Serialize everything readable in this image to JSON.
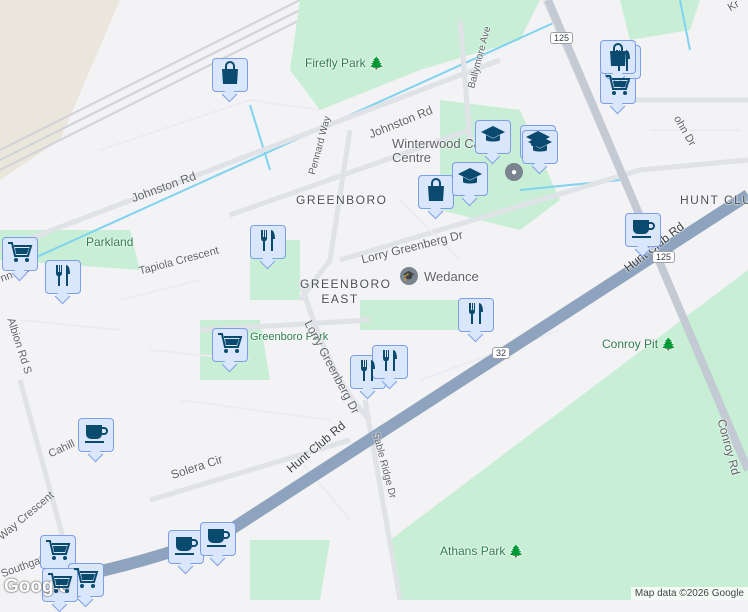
{
  "map": {
    "area_labels": {
      "greenboro": "GREENBORO",
      "greenboro_east": "GREENBORO EAST",
      "hunt_club": "HUNT CLUB"
    },
    "parks": {
      "firefly": "Firefly Park",
      "parkland": "Parkland",
      "greenboro_park": "Greenboro Park",
      "conroy_pit": "Conroy Pit",
      "athans": "Athans Park"
    },
    "streets": {
      "johnston_rd_1": "Johnston Rd",
      "johnston_rd_2": "Johnston Rd",
      "pennard": "Pennard Way",
      "ballymore": "Ballymore Ave",
      "lorry_1": "Lorry Greenberg Dr",
      "lorry_2": "Lorry Greenberg Dr",
      "tapiola": "Tapiola Crescent",
      "hunt_club_rd_1": "Hunt Club Rd",
      "hunt_club_rd_2": "Hunt Club Rd",
      "sable": "Sable Ridge Dr",
      "solera": "Solera Cir",
      "cahill": "Cahill",
      "albion": "Albion Rd S",
      "southgate": "Southgate",
      "way_crescent": "Way Crescent",
      "conroy_rd": "Conroy Rd",
      "ohn_dr": "ohn Dr",
      "kr": "Kr",
      "nn_rd": "nn Rd"
    },
    "pois": {
      "winterwood": "Winterwood Care Centre",
      "wedance": "Wedance"
    },
    "route_shields": [
      "125",
      "125",
      "32"
    ],
    "markers": [
      "shopping",
      "restaurant",
      "shopping",
      "school",
      "school",
      "school",
      "school",
      "grocery",
      "restaurant",
      "grocery",
      "restaurant",
      "restaurant",
      "coffee",
      "grocery",
      "restaurant",
      "restaurant",
      "coffee",
      "coffee",
      "coffee",
      "shopping",
      "grocery",
      "grocery",
      "grocery"
    ]
  },
  "attribution": "Map data ©2026 Google",
  "logo": "Google",
  "colors": {
    "park": "#c8efd6",
    "highway": "#8ea3bd",
    "marker_bg": "#d9e6fc",
    "marker_icon": "#0b4a6f",
    "water": "#7fd3ef"
  }
}
